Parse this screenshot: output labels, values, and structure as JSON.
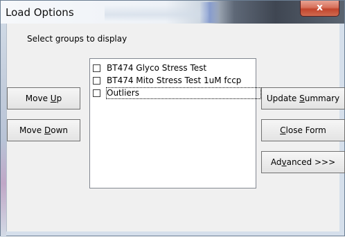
{
  "window": {
    "title": "Load Options",
    "close_glyph": "x"
  },
  "dialog": {
    "prompt": "Select groups to display",
    "buttons": {
      "move_up": {
        "pre": "Move ",
        "key": "U",
        "post": "p"
      },
      "move_down": {
        "pre": "Move ",
        "key": "D",
        "post": "own"
      },
      "update_summary": {
        "pre": "Update ",
        "key": "S",
        "post": "ummary"
      },
      "close_form": {
        "pre": "",
        "key": "C",
        "post": "lose Form"
      },
      "advanced": {
        "pre": "Ad",
        "key": "v",
        "post": "anced >>>"
      }
    },
    "groups": [
      {
        "label": "BT474 Glyco Stress Test",
        "checked": false
      },
      {
        "label": "BT474 Mito Stress Test 1uM fccp",
        "checked": false
      },
      {
        "label": "Outliers",
        "checked": false,
        "focused": true
      }
    ]
  },
  "colors": {
    "close_button": "#c2452d",
    "dialog_bg": "#f0f0f0",
    "frame": "#d5dfeb"
  }
}
